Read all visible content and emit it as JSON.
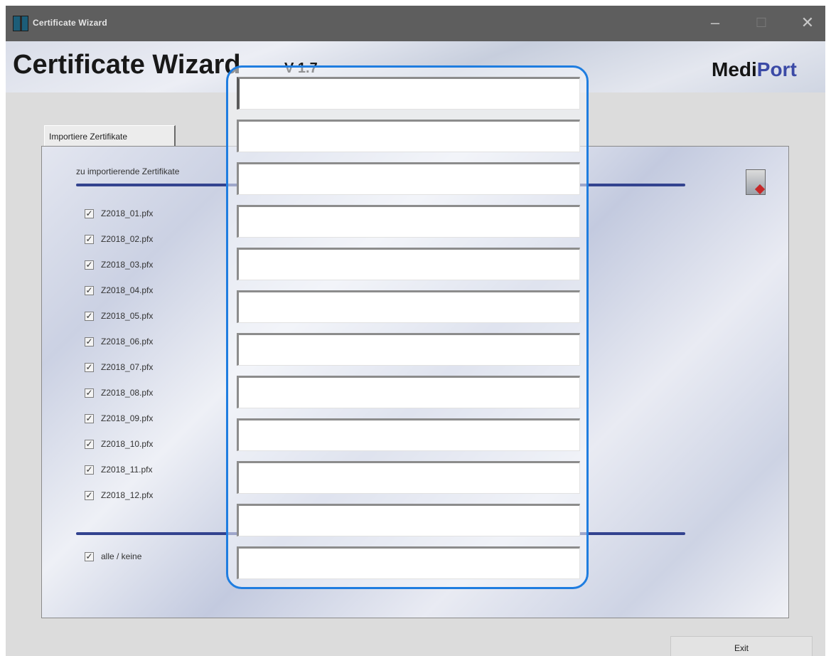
{
  "window": {
    "title": "Certificate Wizard",
    "controls": {
      "minimize": "–",
      "maximize": "☐",
      "close": "✕"
    }
  },
  "header": {
    "app_title": "Certificate Wizard",
    "version": "V 1.7",
    "brand_part1": "Medi",
    "brand_part2": "Port"
  },
  "tab": {
    "label": "Importiere Zertifikate"
  },
  "panel": {
    "section_heading": "zu importierende Zertifikate",
    "files": [
      {
        "name": "Z2018_01.pfx",
        "checked": true
      },
      {
        "name": "Z2018_02.pfx",
        "checked": true
      },
      {
        "name": "Z2018_03.pfx",
        "checked": true
      },
      {
        "name": "Z2018_04.pfx",
        "checked": true
      },
      {
        "name": "Z2018_05.pfx",
        "checked": true
      },
      {
        "name": "Z2018_06.pfx",
        "checked": true
      },
      {
        "name": "Z2018_07.pfx",
        "checked": true
      },
      {
        "name": "Z2018_08.pfx",
        "checked": true
      },
      {
        "name": "Z2018_09.pfx",
        "checked": true
      },
      {
        "name": "Z2018_10.pfx",
        "checked": true
      },
      {
        "name": "Z2018_11.pfx",
        "checked": true
      },
      {
        "name": "Z2018_12.pfx",
        "checked": true
      }
    ],
    "select_all": {
      "label": "alle / keine",
      "checked": true
    },
    "check_mark": "✓"
  },
  "buttons": {
    "exit": "Exit"
  },
  "overlay": {
    "fields": [
      "",
      "",
      "",
      "",
      "",
      "",
      "",
      "",
      "",
      "",
      "",
      ""
    ]
  },
  "colors": {
    "accent": "#1f7de0",
    "rule": "#33438f",
    "brand_blue": "#3b4aa6"
  }
}
